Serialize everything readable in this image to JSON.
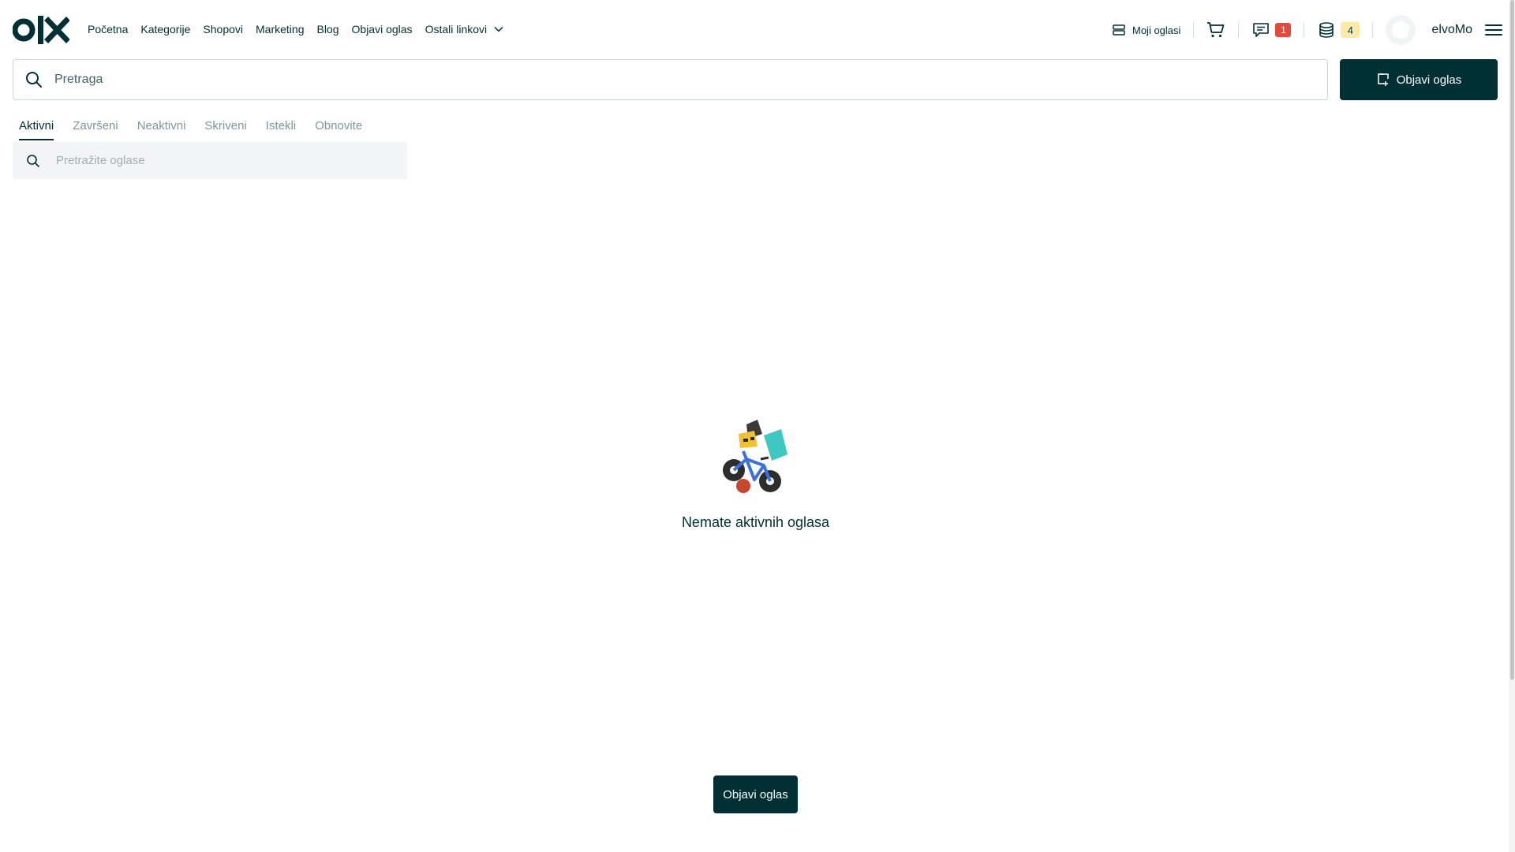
{
  "brand": {
    "logo_text": "OLX",
    "accent": "#002f34",
    "badge_red": "#e8483b",
    "badge_yellow": "#fdeaa7"
  },
  "nav": {
    "items": [
      "Početna",
      "Kategorije",
      "Shopovi",
      "Marketing",
      "Blog",
      "Objavi oglas"
    ],
    "more_label": "Ostali linkovi"
  },
  "header": {
    "my_ads_label": "Moji oglasi",
    "messages_count": "1",
    "credits_count": "4",
    "username": "elvoMo"
  },
  "search": {
    "placeholder": "Pretraga"
  },
  "post_button_label": "Objavi oglas",
  "tabs": [
    {
      "label": "Aktivni",
      "active": true
    },
    {
      "label": "Završeni",
      "active": false
    },
    {
      "label": "Neaktivni",
      "active": false
    },
    {
      "label": "Skriveni",
      "active": false
    },
    {
      "label": "Istekli",
      "active": false
    },
    {
      "label": "Obnovite",
      "active": false
    }
  ],
  "ad_search": {
    "placeholder": "Pretražite oglase"
  },
  "empty_state": {
    "message": "Nemate aktivnih oglasa"
  },
  "bottom_button_label": "Objavi oglas"
}
